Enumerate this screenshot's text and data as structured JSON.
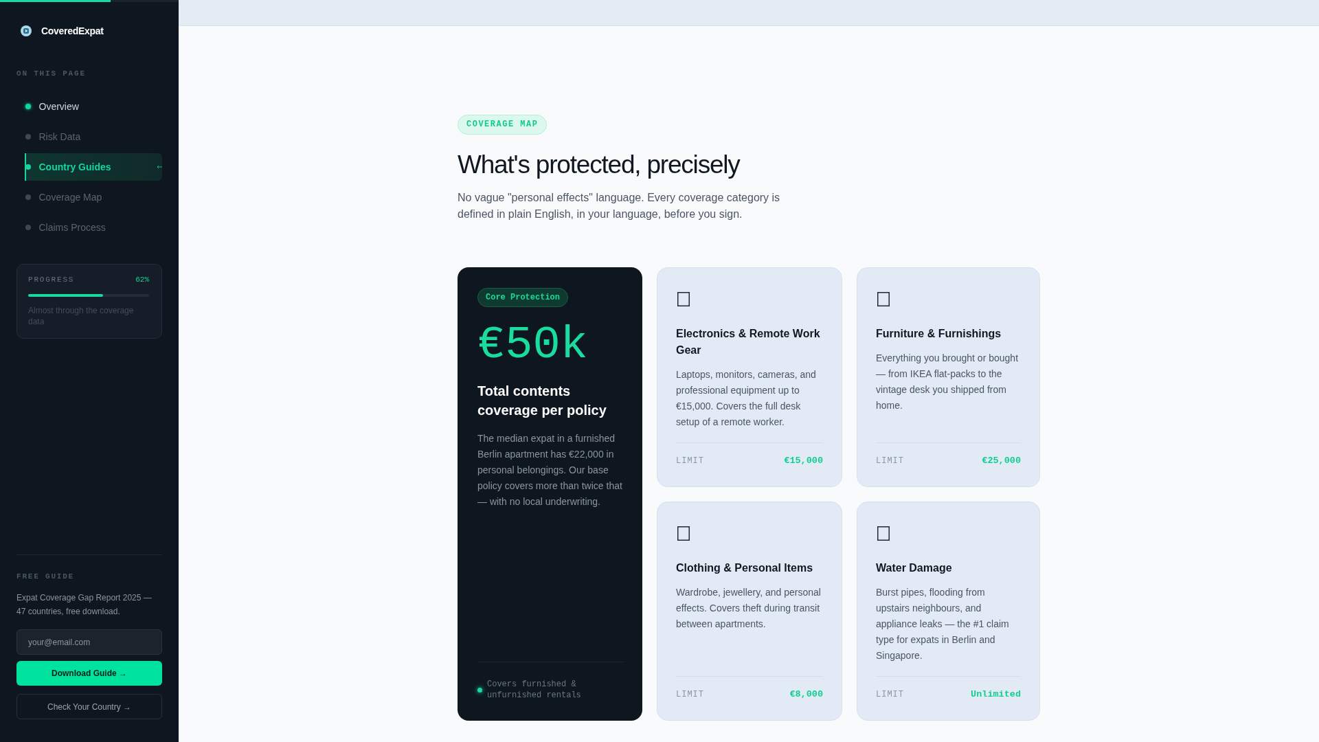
{
  "sidebar": {
    "reading_progress": {
      "level": 0.62
    },
    "brand": {
      "name": "CoveredExpat"
    },
    "nav_heading": "ON THIS PAGE",
    "nav_items": [
      {
        "label": "Overview",
        "completed": true,
        "selected": false
      },
      {
        "label": "Risk Data",
        "completed": false,
        "selected": false
      },
      {
        "label": "Country Guides",
        "completed": false,
        "selected": true
      },
      {
        "label": "Coverage Map",
        "completed": false,
        "selected": false
      },
      {
        "label": "Claims Process",
        "completed": false,
        "selected": false
      }
    ],
    "progress": {
      "label": "PROGRESS",
      "value": "62%",
      "level": 0.62,
      "note": "Almost through the coverage data"
    },
    "free_guide": {
      "heading": "FREE GUIDE",
      "text": "Expat Coverage Gap Report 2025 — 47 countries, free download.",
      "email_field": {
        "placeholder": "your@email.com"
      },
      "buttons": [
        {
          "label": "Download Guide →",
          "kind": "primary"
        },
        {
          "label": "Check Your Country →",
          "kind": "secondary"
        }
      ]
    }
  },
  "main": {
    "tag": "COVERAGE MAP",
    "title": "What's protected, precisely",
    "intro": "No vague \"personal effects\" language. Every coverage category is defined in plain English, in your language, before you sign.",
    "cards": [
      {
        "kind": "featured",
        "badge": "Core Protection",
        "amount": "€50k",
        "title": "Total contents coverage per policy",
        "description": "The median expat in a furnished Berlin apartment has €22,000 in personal belongings. Our base policy covers more than twice that — with no local underwriting.",
        "footnote": "Covers furnished & unfurnished rentals"
      },
      {
        "kind": "category",
        "title": "Electronics & Remote Work Gear",
        "description": "Laptops, monitors, cameras, and professional equipment up to €15,000. Covers the full desk setup of a remote worker.",
        "limit_label": "LIMIT",
        "limit": "€15,000"
      },
      {
        "kind": "category",
        "title": "Furniture & Furnishings",
        "description": "Everything you brought or bought — from IKEA flat-packs to the vintage desk you shipped from home.",
        "limit_label": "LIMIT",
        "limit": "€25,000"
      },
      {
        "kind": "category",
        "title": "Clothing & Personal Items",
        "description": "Wardrobe, jewellery, and personal effects. Covers theft during transit between apartments.",
        "limit_label": "LIMIT",
        "limit": "€8,000"
      },
      {
        "kind": "category",
        "title": "Water Damage",
        "description": "Burst pipes, flooding from upstairs neighbours, and appliance leaks — the #1 claim type for expats in Berlin and Singapore.",
        "limit_label": "LIMIT",
        "limit": "Unlimited"
      }
    ]
  }
}
